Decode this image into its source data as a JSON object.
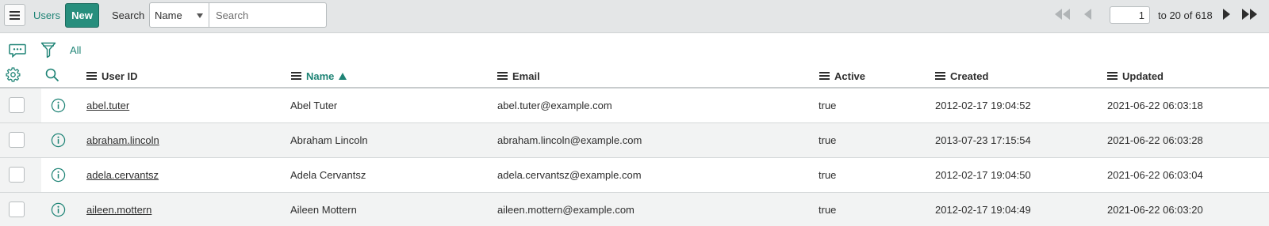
{
  "header": {
    "menu_icon": "hamburger-icon",
    "title": "Users",
    "new_label": "New",
    "search_label": "Search",
    "search_field": "Name",
    "search_placeholder": "Search"
  },
  "pager": {
    "current_page": "1",
    "range_text": "to 20 of 618",
    "icons": [
      "first-page-icon",
      "previous-page-icon",
      "next-page-icon",
      "last-page-icon"
    ]
  },
  "toolbar": {
    "filter_breadcrumb": "All",
    "icons": [
      "comment-icon",
      "filter-icon",
      "gear-icon",
      "search-icon"
    ]
  },
  "columns": [
    {
      "label": "User ID"
    },
    {
      "label": "Name",
      "sorted": "ascending"
    },
    {
      "label": "Email"
    },
    {
      "label": "Active"
    },
    {
      "label": "Created"
    },
    {
      "label": "Updated"
    }
  ],
  "rows": [
    {
      "user_id": "abel.tuter",
      "name": "Abel Tuter",
      "email": "abel.tuter@example.com",
      "active": "true",
      "created": "2012-02-17 19:04:52",
      "updated": "2021-06-22 06:03:18"
    },
    {
      "user_id": "abraham.lincoln",
      "name": "Abraham Lincoln",
      "email": "abraham.lincoln@example.com",
      "active": "true",
      "created": "2013-07-23 17:15:54",
      "updated": "2021-06-22 06:03:28"
    },
    {
      "user_id": "adela.cervantsz",
      "name": "Adela Cervantsz",
      "email": "adela.cervantsz@example.com",
      "active": "true",
      "created": "2012-02-17 19:04:50",
      "updated": "2021-06-22 06:03:04"
    },
    {
      "user_id": "aileen.mottern",
      "name": "Aileen Mottern",
      "email": "aileen.mottern@example.com",
      "active": "true",
      "created": "2012-02-17 19:04:49",
      "updated": "2021-06-22 06:03:20"
    }
  ],
  "colors": {
    "accent": "#1f8476",
    "new_button": "#278e7d",
    "header_bg": "#e4e6e7",
    "alt_row_bg": "#f2f3f3"
  }
}
